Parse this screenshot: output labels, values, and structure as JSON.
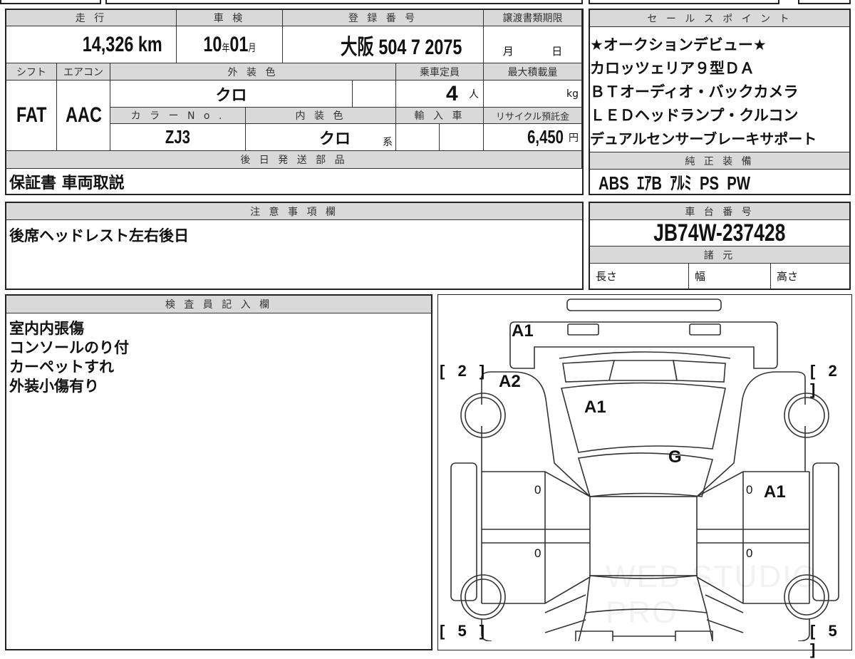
{
  "main": {
    "headers": {
      "mileage": "走 行",
      "inspection": "車 検",
      "registration": "登 録 番 号",
      "transfer_deadline": "譲渡書類期限",
      "shift": "シフト",
      "aircon": "エアコン",
      "exterior_color": "外 装 色",
      "capacity": "乗車定員",
      "max_load": "最大積載量",
      "color_no": "カ ラ ー N o .",
      "interior_color": "内 装 色",
      "imported": "輸 入 車",
      "recycle_fee": "リサイクル預託金",
      "later_parts": "後 日 発 送 部 品"
    },
    "mileage": "14,326",
    "mileage_unit": "km",
    "inspection_year": "10",
    "year_unit": "年",
    "inspection_month": "01",
    "month_unit": "月",
    "registration": "大阪 504 7 2075",
    "deadline_month": "月",
    "deadline_day": "日",
    "shift": "FAT",
    "aircon": "AAC",
    "exterior_color": "クロ",
    "capacity": "4",
    "capacity_unit": "人",
    "load_unit": "kg",
    "color_no": "ZJ3",
    "interior_color": "クロ",
    "interior_suffix": "系",
    "recycle_fee": "6,450",
    "recycle_unit": "円",
    "later_parts": "保証書 車両取説"
  },
  "notes": {
    "header": "注 意 事 項 欄",
    "text": "後席ヘッドレスト左右後日"
  },
  "inspector": {
    "header": "検 査 員 記 入 欄",
    "lines": [
      "室内内張傷",
      "コンソールのり付",
      "カーペットすれ",
      "外装小傷有り"
    ]
  },
  "sales_points": {
    "header": "セ ー ル ス ポ イ ン ト",
    "lines": [
      "★オークションデビュー★",
      "カロッツェリア９型ＤＡ",
      "ＢＴオーディオ・バックカメラ",
      "ＬＥＤヘッドランプ・クルコン",
      "デュアルセンサーブレーキサポート"
    ]
  },
  "equipment": {
    "header": "純 正 装 備",
    "items": "ABS  ｴｱB  ｱﾙﾐ  PS  PW"
  },
  "chassis": {
    "header": "車 台 番 号",
    "number": "JB74W-237428",
    "spec_header": "諸 元",
    "length": "長さ",
    "width": "幅",
    "height": "高さ"
  },
  "diagram": {
    "brackets": {
      "front_left": "[ 2 ]",
      "front_right": "[ 2 ]",
      "rear_left": "[ 5 ]",
      "rear_right": "[ 5 ]"
    },
    "marks": {
      "front_bumper": "A1",
      "left_fender": "A2",
      "hood": "A1",
      "windshield": "G",
      "right_front_door": "A1",
      "door_lf": "0",
      "door_rf": "0",
      "door_lr": "0",
      "door_rr": "0"
    },
    "watermark": "WEB STUDIO PRO"
  }
}
